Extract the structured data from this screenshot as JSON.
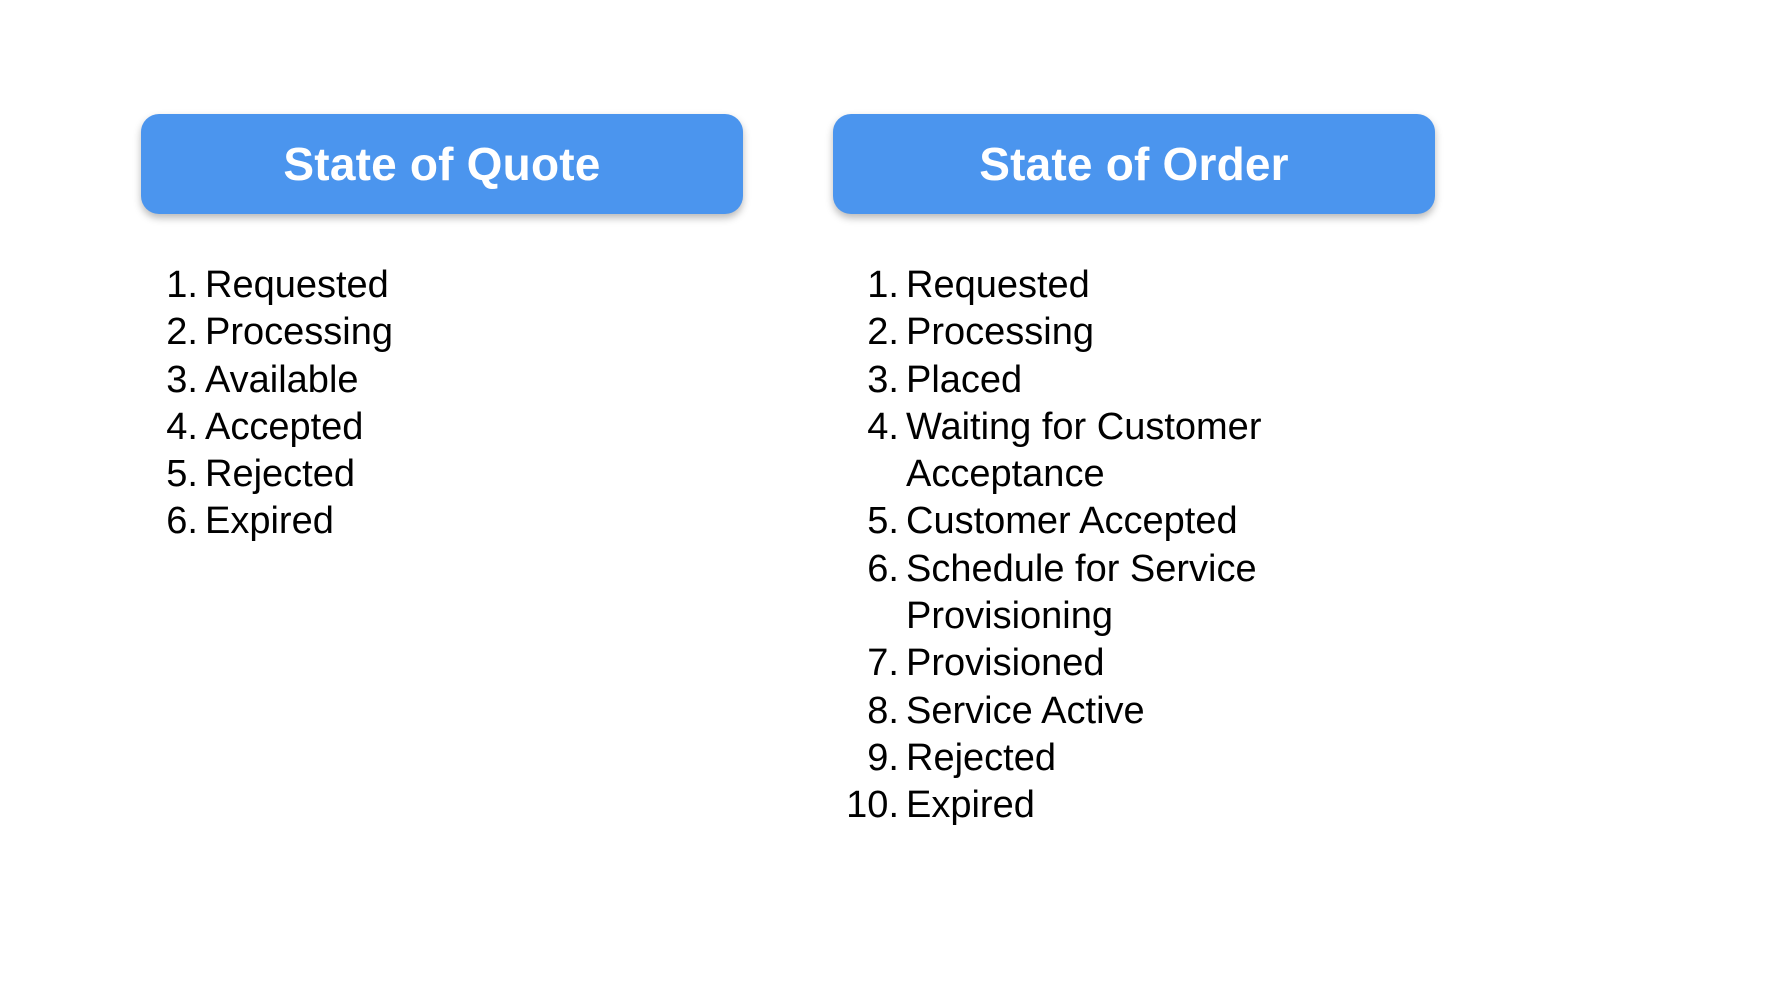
{
  "quote": {
    "title": "State of Quote",
    "states": [
      {
        "num": "1.",
        "label": "Requested"
      },
      {
        "num": "2.",
        "label": "Processing"
      },
      {
        "num": "3.",
        "label": "Available"
      },
      {
        "num": "4.",
        "label": "Accepted"
      },
      {
        "num": "5.",
        "label": "Rejected"
      },
      {
        "num": "6.",
        "label": "Expired"
      }
    ]
  },
  "order": {
    "title": "State of Order",
    "states": [
      {
        "num": "1.",
        "label": "Requested"
      },
      {
        "num": "2.",
        "label": "Processing"
      },
      {
        "num": "3.",
        "label": "Placed"
      },
      {
        "num": "4.",
        "label": "Waiting for Customer Acceptance"
      },
      {
        "num": "5.",
        "label": "Customer Accepted"
      },
      {
        "num": "6.",
        "label": "Schedule for Service Provisioning"
      },
      {
        "num": "7.",
        "label": "Provisioned"
      },
      {
        "num": "8.",
        "label": "Service Active"
      },
      {
        "num": "9.",
        "label": "Rejected"
      },
      {
        "num": "10.",
        "label": "Expired"
      }
    ]
  },
  "colors": {
    "header_bg": "#4b95ee",
    "header_text": "#ffffff",
    "body_text": "#000000"
  }
}
